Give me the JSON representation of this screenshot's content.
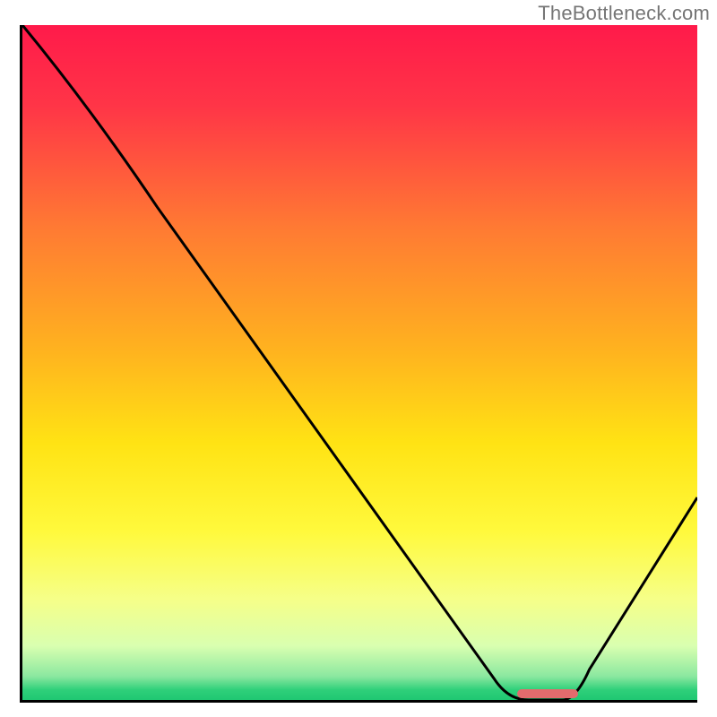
{
  "watermark": "TheBottleneck.com",
  "chart_data": {
    "type": "line",
    "title": "",
    "xlabel": "",
    "ylabel": "",
    "xlim": [
      0,
      100
    ],
    "ylim": [
      0,
      100
    ],
    "x": [
      0,
      20,
      70,
      75,
      80,
      100
    ],
    "values": [
      100,
      73,
      3,
      0,
      0,
      30
    ],
    "gradient_stops": [
      {
        "pos": 0.0,
        "color": "#ff1a4a"
      },
      {
        "pos": 0.12,
        "color": "#ff3547"
      },
      {
        "pos": 0.3,
        "color": "#ff7a33"
      },
      {
        "pos": 0.48,
        "color": "#ffb21f"
      },
      {
        "pos": 0.62,
        "color": "#ffe314"
      },
      {
        "pos": 0.75,
        "color": "#fff93c"
      },
      {
        "pos": 0.85,
        "color": "#f6ff88"
      },
      {
        "pos": 0.92,
        "color": "#d9ffb0"
      },
      {
        "pos": 0.965,
        "color": "#8be8a0"
      },
      {
        "pos": 0.985,
        "color": "#2fd07a"
      },
      {
        "pos": 1.0,
        "color": "#1fc772"
      }
    ],
    "marker": {
      "x_start": 73,
      "x_end": 82,
      "y": 0,
      "color": "#e36b6d"
    }
  }
}
